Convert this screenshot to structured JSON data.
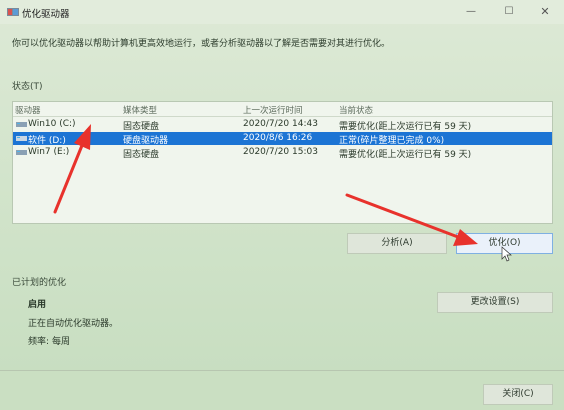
{
  "window": {
    "title": "优化驱动器",
    "minimize": "—",
    "maximize": "☐",
    "close": "✕"
  },
  "description": "你可以优化驱动器以帮助计算机更高效地运行，或者分析驱动器以了解是否需要对其进行优化。",
  "status": {
    "label": "状态(T)",
    "columns": [
      "驱动器",
      "媒体类型",
      "上一次运行时间",
      "当前状态"
    ],
    "rows": [
      {
        "drive": "Win10 (C:)",
        "media": "固态硬盘",
        "last_run": "2020/7/20 14:43",
        "status": "需要优化(距上次运行已有 59 天)"
      },
      {
        "drive": "软件 (D:)",
        "media": "硬盘驱动器",
        "last_run": "2020/8/6 16:26",
        "status": "正常(碎片整理已完成 0%)"
      },
      {
        "drive": "Win7 (E:)",
        "media": "固态硬盘",
        "last_run": "2020/7/20 15:03",
        "status": "需要优化(距上次运行已有 59 天)"
      }
    ],
    "selected_row": 1
  },
  "buttons": {
    "analyze": "分析(A)",
    "optimize": "优化(O)",
    "change_settings": "更改设置(S)",
    "close": "关闭(C)"
  },
  "scheduled": {
    "label": "已计划的优化",
    "state": "启用",
    "running": "正在自动优化驱动器。",
    "frequency_label": "频率:",
    "frequency_value": "每周"
  },
  "colors": {
    "selection": "#1c74d4",
    "annotation_arrow": "#e8322c"
  },
  "icons": {
    "app": "defrag-icon",
    "drive": "drive-icon"
  }
}
